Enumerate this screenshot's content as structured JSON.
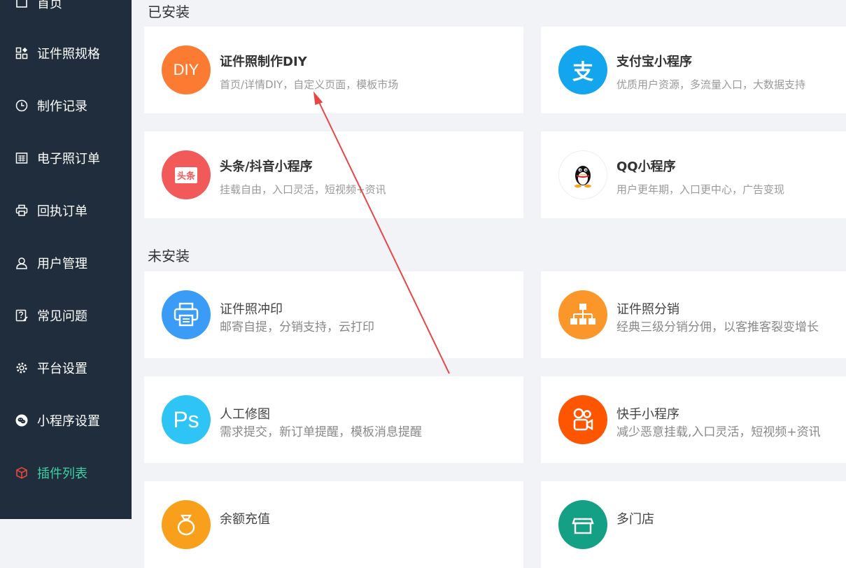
{
  "sidebar": {
    "items": [
      {
        "label": "首页",
        "icon": "home-icon"
      },
      {
        "label": "证件照规格",
        "icon": "grid-icon"
      },
      {
        "label": "制作记录",
        "icon": "clock-icon"
      },
      {
        "label": "电子照订单",
        "icon": "calendar-icon"
      },
      {
        "label": "回执订单",
        "icon": "printer-icon"
      },
      {
        "label": "用户管理",
        "icon": "user-icon"
      },
      {
        "label": "常见问题",
        "icon": "question-edit-icon"
      },
      {
        "label": "平台设置",
        "icon": "gear-icon"
      },
      {
        "label": "小程序设置",
        "icon": "wechat-icon"
      },
      {
        "label": "插件列表",
        "icon": "cube-icon",
        "active": true
      }
    ],
    "active_color": "#3fd1a2",
    "background": "#1f2d3d"
  },
  "installed": {
    "title": "已安装",
    "cards": [
      {
        "title": "证件照制作DIY",
        "desc": "首页/详情DIY，自定义页面，模板市场",
        "icon": "diy-icon",
        "icon_text": "DIY",
        "color": "#fc7b33"
      },
      {
        "title": "支付宝小程序",
        "desc": "优质用户资源，多流量入口，大数据支持",
        "icon": "alipay-icon",
        "icon_text": "支",
        "color": "#13a6ef"
      },
      {
        "title": "头条/抖音小程序",
        "desc": "挂载自由，入口灵活，短视频+资讯",
        "icon": "toutiao-icon",
        "icon_text": "头条",
        "color": "#f25a5a"
      },
      {
        "title": "QQ小程序",
        "desc": "用户更年期，入口更中心，广告变现",
        "icon": "qq-penguin-icon",
        "color": "#ffffff"
      }
    ]
  },
  "uninstalled": {
    "title": "未安装",
    "cards": [
      {
        "title": "证件照冲印",
        "desc": "邮寄自提，分销支持，云打印",
        "icon": "printer-icon",
        "color": "#3a9cf6"
      },
      {
        "title": "证件照分销",
        "desc": "经典三级分销分佣，以客推客裂变增长",
        "icon": "hierarchy-icon",
        "color": "#fb962b"
      },
      {
        "title": "人工修图",
        "desc": "需求提交，新订单提醒，模板消息提醒",
        "icon": "photoshop-icon",
        "icon_text": "Ps",
        "color": "#2fc4f6"
      },
      {
        "title": "快手小程序",
        "desc": "减少恶意挂载,入口灵活，短视频+资讯",
        "icon": "kuaishou-camera-icon",
        "color": "#fe5500"
      },
      {
        "title": "余额充值",
        "desc": "",
        "icon": "wallet-icon",
        "color": "#f8a01c"
      },
      {
        "title": "多门店",
        "desc": "",
        "icon": "store-icon",
        "color": "#14a085"
      }
    ]
  },
  "annotation_color": "#e84545"
}
